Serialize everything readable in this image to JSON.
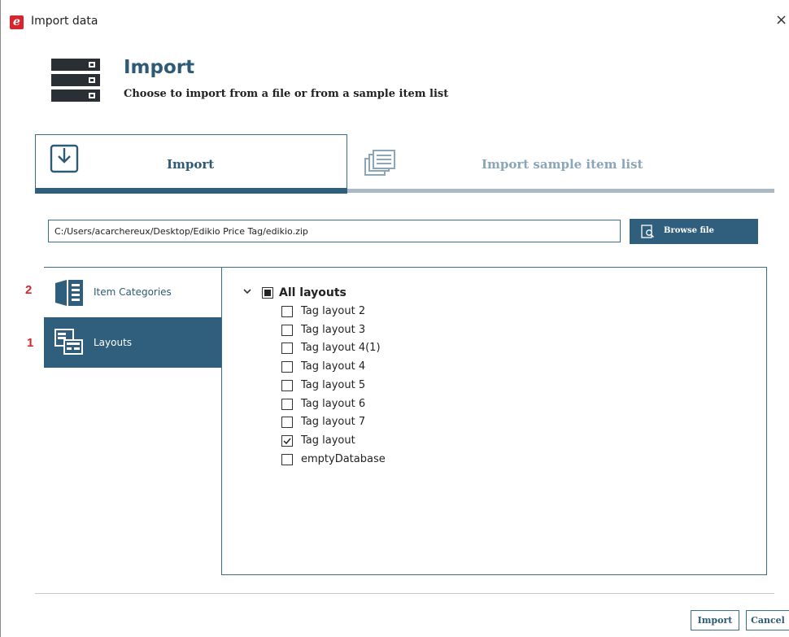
{
  "window": {
    "title": "Import data",
    "close_glyph": "×",
    "app_icon_letter": "e",
    "brand_color": "#d9232d"
  },
  "header": {
    "title": "Import",
    "subtitle": "Choose to import from a file or from a sample item list",
    "icon": "database-stack-icon"
  },
  "tabs": [
    {
      "label": "Import",
      "icon": "download-tray-icon",
      "active": true
    },
    {
      "label": "Import sample item list",
      "icon": "stacked-list-icon",
      "active": false
    }
  ],
  "file": {
    "path": "C:/Users/acarchereux/Desktop/Edikio Price Tag/edikio.zip",
    "browse_label": "Browse file"
  },
  "sidebar": {
    "items": [
      {
        "number": "2",
        "label": "Item Categories",
        "icon": "categories-icon",
        "selected": false
      },
      {
        "number": "1",
        "label": "Layouts",
        "icon": "layouts-icon",
        "selected": true
      }
    ]
  },
  "tree": {
    "root": {
      "label": "All layouts",
      "expanded": true,
      "state": "partial"
    },
    "children": [
      {
        "label": "Tag layout 2",
        "checked": false
      },
      {
        "label": "Tag layout 3",
        "checked": false
      },
      {
        "label": "Tag layout 4(1)",
        "checked": false
      },
      {
        "label": "Tag layout 4",
        "checked": false
      },
      {
        "label": "Tag layout 5",
        "checked": false
      },
      {
        "label": "Tag layout 6",
        "checked": false
      },
      {
        "label": "Tag layout 7",
        "checked": false
      },
      {
        "label": "Tag layout",
        "checked": true
      },
      {
        "label": "emptyDatabase",
        "checked": false
      }
    ]
  },
  "footer": {
    "import_label": "Import",
    "cancel_label": "Cancel"
  },
  "colors": {
    "accent": "#2f5f7c",
    "heading": "#2d5b75",
    "inactive_tab": "#8aa6b8",
    "marker": "#d9232d"
  }
}
